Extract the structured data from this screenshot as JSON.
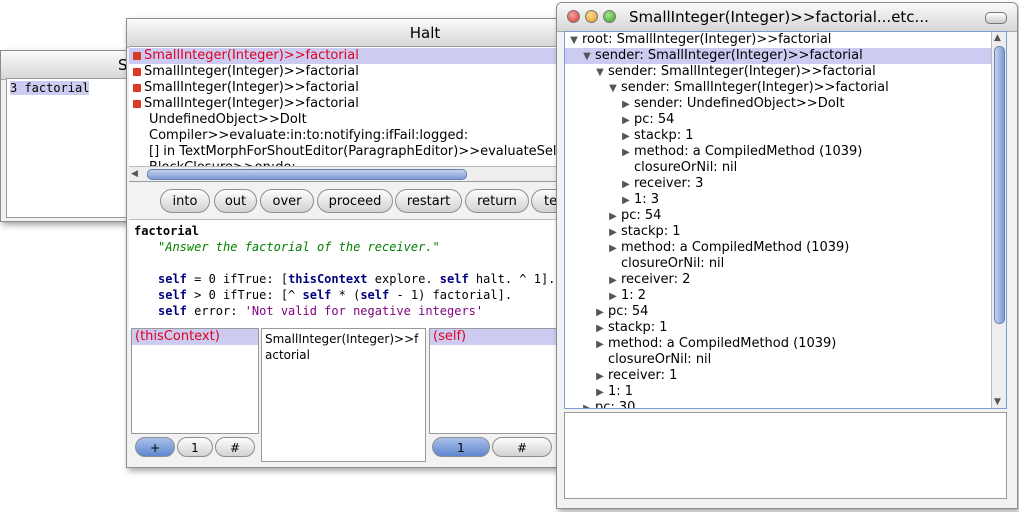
{
  "workspace": {
    "title_partial": "S",
    "selected_text": "3 factorial"
  },
  "debugger": {
    "title": "Halt",
    "stack": [
      {
        "label": "SmallInteger(Integer)>>factorial",
        "flag": true,
        "selected": true
      },
      {
        "label": "SmallInteger(Integer)>>factorial",
        "flag": true,
        "selected": false
      },
      {
        "label": "SmallInteger(Integer)>>factorial",
        "flag": true,
        "selected": false
      },
      {
        "label": "SmallInteger(Integer)>>factorial",
        "flag": true,
        "selected": false
      },
      {
        "label": "UndefinedObject>>DoIt",
        "flag": false,
        "selected": false
      },
      {
        "label": "Compiler>>evaluate:in:to:notifying:ifFail:logged:",
        "flag": false,
        "selected": false
      },
      {
        "label": "[] in TextMorphForShoutEditor(ParagraphEditor)>>evaluateSele",
        "flag": false,
        "selected": false
      },
      {
        "label": "BlockClosure>>on:do:",
        "flag": false,
        "selected": false
      }
    ],
    "buttons": [
      "into",
      "out",
      "over",
      "proceed",
      "restart",
      "return",
      "ter"
    ],
    "code": {
      "method_name": "factorial",
      "comment": "\"Answer the factorial of the receiver.\"",
      "self_kw": "self",
      "this_context": "thisContext",
      "line1_a": " = 0 ifTrue: [",
      "line1_b": " explore. ",
      "line1_c": " halt. ^ 1].",
      "line2_a": " > 0 ifTrue: [^ ",
      "line2_b": " * (",
      "line2_c": " - 1) factorial].",
      "line3_a": " error: ",
      "line3_str": "'Not valid for negative integers'"
    },
    "context_inspector": {
      "selected_item": "(thisContext)",
      "value_text": "SmallInteger(Integer)>>factorial",
      "buttons": [
        "+",
        "1",
        "#"
      ]
    },
    "receiver_inspector": {
      "selected_item": "(self)",
      "buttons": [
        "1",
        "#"
      ]
    }
  },
  "explorer": {
    "title": "SmallInteger(Integer)>>factorial...etc...",
    "tree": [
      {
        "label": "root: SmallInteger(Integer)>>factorial",
        "depth": 0,
        "expanded": true,
        "selected": false
      },
      {
        "label": "sender: SmallInteger(Integer)>>factorial",
        "depth": 1,
        "expanded": true,
        "selected": true
      },
      {
        "label": "sender: SmallInteger(Integer)>>factorial",
        "depth": 2,
        "expanded": true,
        "selected": false
      },
      {
        "label": "sender: SmallInteger(Integer)>>factorial",
        "depth": 3,
        "expanded": true,
        "selected": false
      },
      {
        "label": "sender: UndefinedObject>>DoIt",
        "depth": 4,
        "expanded": false,
        "selected": false
      },
      {
        "label": "pc: 54",
        "depth": 4,
        "expanded": false,
        "selected": false
      },
      {
        "label": "stackp: 1",
        "depth": 4,
        "expanded": false,
        "selected": false
      },
      {
        "label": "method: a CompiledMethod (1039)",
        "depth": 4,
        "expanded": false,
        "selected": false
      },
      {
        "label": "closureOrNil: nil",
        "depth": 4,
        "expanded": null,
        "selected": false
      },
      {
        "label": "receiver: 3",
        "depth": 4,
        "expanded": false,
        "selected": false
      },
      {
        "label": "1: 3",
        "depth": 4,
        "expanded": false,
        "selected": false
      },
      {
        "label": "pc: 54",
        "depth": 3,
        "expanded": false,
        "selected": false
      },
      {
        "label": "stackp: 1",
        "depth": 3,
        "expanded": false,
        "selected": false
      },
      {
        "label": "method: a CompiledMethod (1039)",
        "depth": 3,
        "expanded": false,
        "selected": false
      },
      {
        "label": "closureOrNil: nil",
        "depth": 3,
        "expanded": null,
        "selected": false
      },
      {
        "label": "receiver: 2",
        "depth": 3,
        "expanded": false,
        "selected": false
      },
      {
        "label": "1: 2",
        "depth": 3,
        "expanded": false,
        "selected": false
      },
      {
        "label": "pc: 54",
        "depth": 2,
        "expanded": false,
        "selected": false
      },
      {
        "label": "stackp: 1",
        "depth": 2,
        "expanded": false,
        "selected": false
      },
      {
        "label": "method: a CompiledMethod (1039)",
        "depth": 2,
        "expanded": false,
        "selected": false
      },
      {
        "label": "closureOrNil: nil",
        "depth": 2,
        "expanded": null,
        "selected": false
      },
      {
        "label": "receiver: 1",
        "depth": 2,
        "expanded": false,
        "selected": false
      },
      {
        "label": "1: 1",
        "depth": 2,
        "expanded": false,
        "selected": false
      },
      {
        "label": "pc: 30",
        "depth": 1,
        "expanded": false,
        "selected": false
      }
    ]
  },
  "colors": {
    "selection": "#ccccf2",
    "selected_frame_text": "#e0001c",
    "close_button": "#e0443a",
    "minimize_button": "#f2b33a",
    "zoom_button": "#5cbf3a"
  }
}
